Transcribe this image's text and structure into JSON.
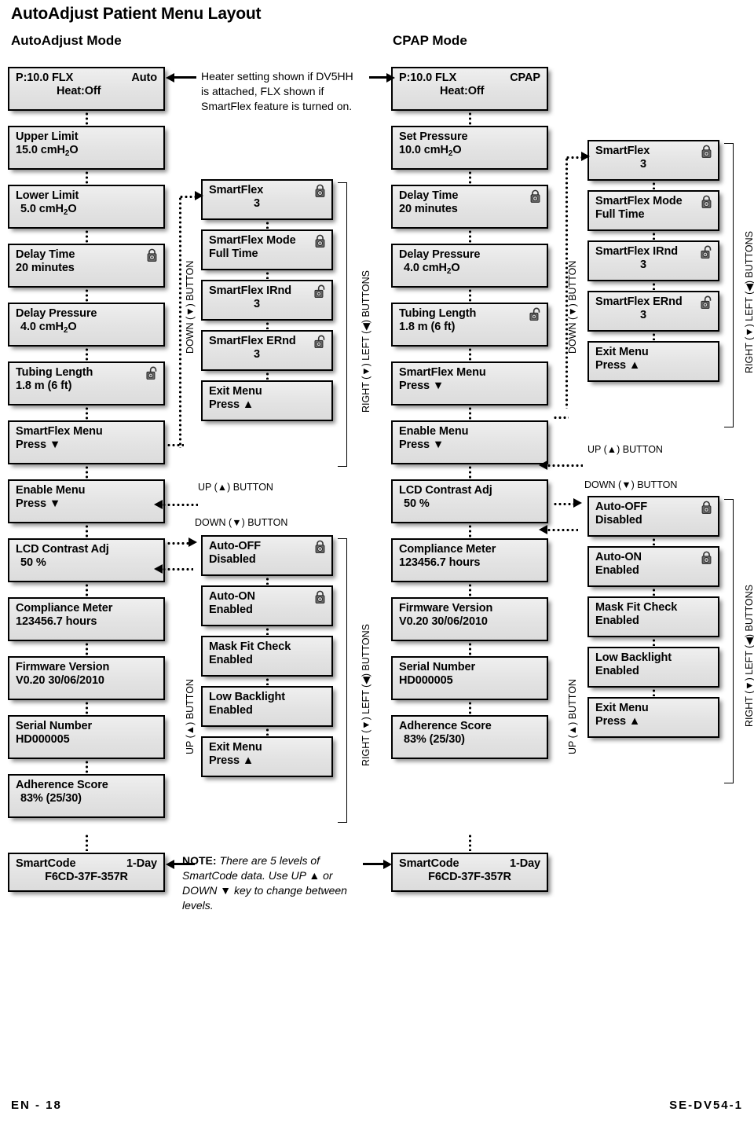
{
  "document": {
    "title": "AutoAdjust Patient Menu Layout",
    "footer_left": "EN - 18",
    "footer_right": "SE-DV54-1"
  },
  "sections": {
    "autoadjust_mode_title": "AutoAdjust Mode",
    "cpap_mode_title": "CPAP Mode"
  },
  "notes": {
    "heater": "Heater setting shown if DV5HH is attached, FLX shown if SmartFlex feature is turned on.",
    "smartcode_label": "NOTE:",
    "smartcode_body": "There are 5 levels of SmartCode data. Use UP ▲ or DOWN ▼ key to change between levels."
  },
  "button_labels": {
    "down": "DOWN (▼) BUTTON",
    "up": "UP (▲) BUTTON",
    "right_left": "RIGHT (▼) LEFT (◀) BUTTONS"
  },
  "autoadjust_main": [
    {
      "line1": "P:10.0  FLX",
      "line1b": "Auto",
      "line2": "Heat:Off",
      "lock": "none",
      "layout": "split"
    },
    {
      "line1": "Upper Limit",
      "line2": "15.0 cmH2O",
      "lock": "none"
    },
    {
      "line1": "Lower Limit",
      "line2": "5.0 cmH2O",
      "lock": "none",
      "indent": true
    },
    {
      "line1": "Delay Time",
      "line2": "20 minutes",
      "lock": "closed"
    },
    {
      "line1": "Delay Pressure",
      "line2": "4.0 cmH2O",
      "lock": "none",
      "indent": true
    },
    {
      "line1": "Tubing Length",
      "line2": "1.8 m (6 ft)",
      "lock": "open"
    },
    {
      "line1": "SmartFlex Menu",
      "line2": "Press ▼",
      "lock": "none"
    },
    {
      "line1": "Enable Menu",
      "line2": "Press ▼",
      "lock": "none"
    },
    {
      "line1": "LCD Contrast Adj",
      "line2": "50 %",
      "lock": "none",
      "indent": true
    },
    {
      "line1": "Compliance Meter",
      "line2": "123456.7 hours",
      "lock": "none"
    },
    {
      "line1": "Firmware Version",
      "line2": "V0.20 30/06/2010",
      "lock": "none"
    },
    {
      "line1": "Serial Number",
      "line2": "HD000005",
      "lock": "none"
    },
    {
      "line1": "Adherence  Score",
      "line2": "83% (25/30)",
      "lock": "none",
      "indent": true
    }
  ],
  "autoadjust_smartcode": {
    "line1": "SmartCode",
    "line1b": "1-Day",
    "line2": "F6CD-37F-357R",
    "lock": "none",
    "layout": "split",
    "center2": true
  },
  "autoadjust_smartflex": [
    {
      "line1": "SmartFlex",
      "line2": "3",
      "lock": "closed",
      "val": true
    },
    {
      "line1": "SmartFlex Mode",
      "line2": "Full Time",
      "lock": "closed"
    },
    {
      "line1": "SmartFlex IRnd",
      "line2": "3",
      "lock": "open",
      "val": true
    },
    {
      "line1": "SmartFlex ERnd",
      "line2": "3",
      "lock": "open",
      "val": true
    },
    {
      "line1": "Exit Menu",
      "line2": "Press ▲",
      "lock": "none"
    }
  ],
  "autoadjust_enable": [
    {
      "line1": "Auto-OFF",
      "line2": "Disabled",
      "lock": "closed"
    },
    {
      "line1": "Auto-ON",
      "line2": "Enabled",
      "lock": "closed"
    },
    {
      "line1": "Mask Fit Check",
      "line2": "Enabled",
      "lock": "none"
    },
    {
      "line1": "Low Backlight",
      "line2": "Enabled",
      "lock": "none"
    },
    {
      "line1": "Exit Menu",
      "line2": "Press ▲",
      "lock": "none"
    }
  ],
  "cpap_main": [
    {
      "line1": "P:10.0  FLX",
      "line1b": "CPAP",
      "line2": "Heat:Off",
      "lock": "none",
      "layout": "split"
    },
    {
      "line1": "Set Pressure",
      "line2": "10.0 cmH2O",
      "lock": "none"
    },
    {
      "line1": "Delay Time",
      "line2": "20 minutes",
      "lock": "closed"
    },
    {
      "line1": "Delay Pressure",
      "line2": "4.0 cmH2O",
      "lock": "none",
      "indent": true
    },
    {
      "line1": "Tubing Length",
      "line2": "1.8 m (6 ft)",
      "lock": "open"
    },
    {
      "line1": "SmartFlex Menu",
      "line2": "Press ▼",
      "lock": "none"
    },
    {
      "line1": "Enable Menu",
      "line2": "Press ▼",
      "lock": "none"
    },
    {
      "line1": "LCD Contrast Adj",
      "line2": "50 %",
      "lock": "none",
      "indent": true
    },
    {
      "line1": "Compliance Meter",
      "line2": "123456.7 hours",
      "lock": "none"
    },
    {
      "line1": "Firmware Version",
      "line2": "V0.20 30/06/2010",
      "lock": "none"
    },
    {
      "line1": "Serial Number",
      "line2": "HD000005",
      "lock": "none"
    },
    {
      "line1": "Adherence  Score",
      "line2": "83% (25/30)",
      "lock": "none",
      "indent": true
    }
  ],
  "cpap_smartcode": {
    "line1": "SmartCode",
    "line1b": "1-Day",
    "line2": "F6CD-37F-357R",
    "lock": "none",
    "layout": "split",
    "center2": true
  },
  "cpap_smartflex": [
    {
      "line1": "SmartFlex",
      "line2": "3",
      "lock": "closed",
      "val": true
    },
    {
      "line1": "SmartFlex Mode",
      "line2": "Full Time",
      "lock": "closed"
    },
    {
      "line1": "SmartFlex IRnd",
      "line2": "3",
      "lock": "open",
      "val": true
    },
    {
      "line1": "SmartFlex ERnd",
      "line2": "3",
      "lock": "open",
      "val": true
    },
    {
      "line1": "Exit Menu",
      "line2": "Press ▲",
      "lock": "none"
    }
  ],
  "cpap_enable": [
    {
      "line1": "Auto-OFF",
      "line2": "Disabled",
      "lock": "closed"
    },
    {
      "line1": "Auto-ON",
      "line2": "Enabled",
      "lock": "closed"
    },
    {
      "line1": "Mask Fit Check",
      "line2": "Enabled",
      "lock": "none"
    },
    {
      "line1": "Low Backlight",
      "line2": "Enabled",
      "lock": "none"
    },
    {
      "line1": "Exit Menu",
      "line2": "Press ▲",
      "lock": "none"
    }
  ]
}
